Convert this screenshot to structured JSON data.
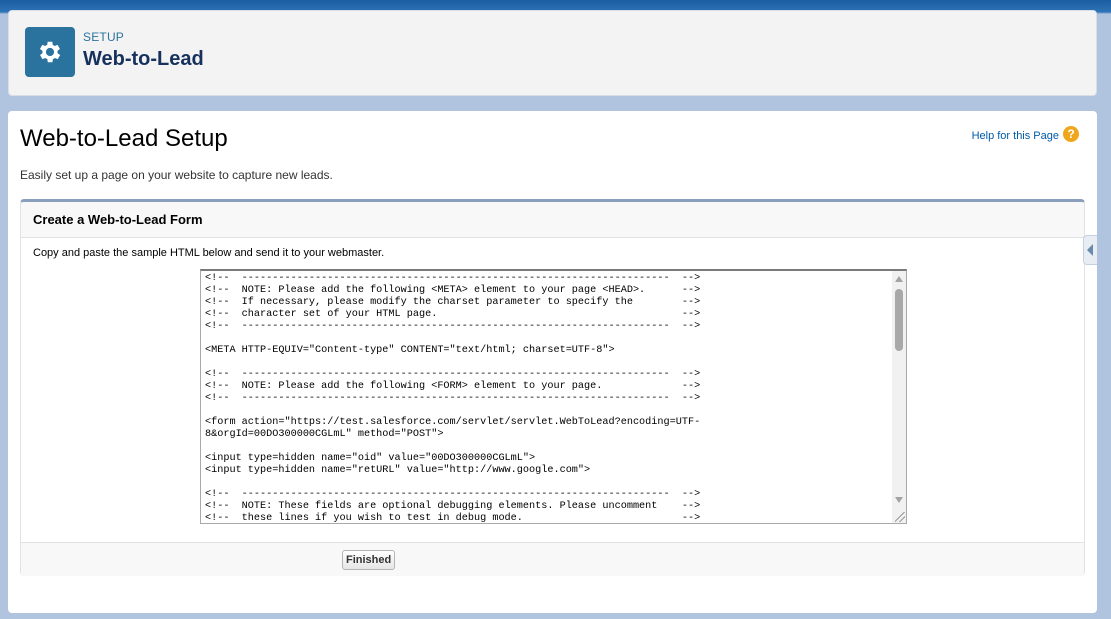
{
  "header": {
    "breadcrumb": "SETUP",
    "title": "Web-to-Lead",
    "icon": "gear-icon"
  },
  "page": {
    "title": "Web-to-Lead Setup",
    "help_link": "Help for this Page",
    "intro": "Easily set up a page on your website to capture new leads."
  },
  "section": {
    "title": "Create a Web-to-Lead Form",
    "instructions": "Copy and paste the sample HTML below and send it to your webmaster.",
    "code": "<!--  ----------------------------------------------------------------------  -->\n<!--  NOTE: Please add the following <META> element to your page <HEAD>.      -->\n<!--  If necessary, please modify the charset parameter to specify the        -->\n<!--  character set of your HTML page.                                        -->\n<!--  ----------------------------------------------------------------------  -->\n\n<META HTTP-EQUIV=\"Content-type\" CONTENT=\"text/html; charset=UTF-8\">\n\n<!--  ----------------------------------------------------------------------  -->\n<!--  NOTE: Please add the following <FORM> element to your page.             -->\n<!--  ----------------------------------------------------------------------  -->\n\n<form action=\"https://test.salesforce.com/servlet/servlet.WebToLead?encoding=UTF-\n8&orgId=00DO300000CGLmL\" method=\"POST\">\n\n<input type=hidden name=\"oid\" value=\"00DO300000CGLmL\">\n<input type=hidden name=\"retURL\" value=\"http://www.google.com\">\n\n<!--  ----------------------------------------------------------------------  -->\n<!--  NOTE: These fields are optional debugging elements. Please uncomment    -->\n<!--  these lines if you wish to test in debug mode.                          -->",
    "finished_label": "Finished"
  },
  "colors": {
    "accent": "#2a739e",
    "title_text": "#16325c",
    "link": "#015ba7",
    "help_icon": "#f0a61c"
  }
}
